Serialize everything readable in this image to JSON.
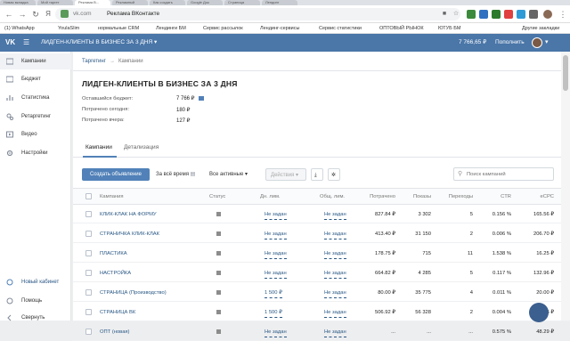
{
  "browser": {
    "tabs": [
      "Новая вкладка",
      "Мой таргет",
      "Реклама В...",
      "Рекламный",
      "Как создать",
      "Google Док",
      "Страница",
      "Лендинг"
    ],
    "url": "vk.com",
    "page_title": "Реклама ВКонтакте",
    "bookmarks": [
      "(1) WhatsApp",
      "YoulaSlim",
      "нормальные CRM",
      "Лендинги БМ",
      "Сервис рассылок",
      "Лендинг-сервисы",
      "Сервис статистики",
      "ОПТОВЫЙ РЫНОК",
      "ЮТУБ БМ",
      "Другие закладки"
    ]
  },
  "header": {
    "logo": "VK",
    "cabinet_name": "ЛИДГЕН-КЛИЕНТЫ В БИЗНЕС ЗА 3 ДНЯ",
    "balance": "7 766,65 ₽",
    "topup": "Пополнить"
  },
  "sidebar": {
    "items": [
      {
        "label": "Кампании",
        "icon": "campaigns-icon"
      },
      {
        "label": "Бюджет",
        "icon": "budget-icon"
      },
      {
        "label": "Статистика",
        "icon": "stats-icon"
      },
      {
        "label": "Ретаргетинг",
        "icon": "retarget-icon"
      },
      {
        "label": "Видео",
        "icon": "video-icon"
      },
      {
        "label": "Настройки",
        "icon": "settings-icon"
      }
    ],
    "bottom": [
      {
        "label": "Новый кабинет",
        "icon": "new-cabinet-icon"
      },
      {
        "label": "Помощь",
        "icon": "help-icon"
      },
      {
        "label": "Свернуть",
        "icon": "collapse-icon"
      }
    ]
  },
  "breadcrumb": {
    "first": "Таргетинг",
    "sep": "→",
    "second": "Кампании"
  },
  "page": {
    "title": "ЛИДГЕН-КЛИЕНТЫ В БИЗНЕС ЗА 3 ДНЯ",
    "stats": [
      {
        "label": "Оставшийся бюджет:",
        "value": "7 766 ₽"
      },
      {
        "label": "Потрачено сегодня:",
        "value": "180 ₽"
      },
      {
        "label": "Потрачено вчера:",
        "value": "127 ₽"
      }
    ]
  },
  "tabs": [
    "Кампании",
    "Детализация"
  ],
  "toolbar": {
    "create": "Создать объявление",
    "period": "За всё время",
    "filter": "Все активные",
    "actions": "Действия",
    "search_placeholder": "Поиск кампаний"
  },
  "table": {
    "headers": [
      "Кампания",
      "Статус",
      "Дн. лим.",
      "Общ. лим.",
      "Потрачено",
      "Показы",
      "Переходы",
      "CTR",
      "eCPC"
    ],
    "rows": [
      {
        "name": "КЛИК-КЛАК НА ФОРМУ",
        "day": "Не задан",
        "total": "Не задан",
        "spent": "827.84 ₽",
        "shows": "3 302",
        "clicks": "5",
        "ctr": "0.156 %",
        "ecpc": "165.56 ₽"
      },
      {
        "name": "СТРАНИЧКА КЛИК-КЛАК",
        "day": "Не задан",
        "total": "Не задан",
        "spent": "413.40 ₽",
        "shows": "31 150",
        "clicks": "2",
        "ctr": "0.006 %",
        "ecpc": "206.70 ₽"
      },
      {
        "name": "ПЛАСТИКА",
        "day": "Не задан",
        "total": "Не задан",
        "spent": "178.75 ₽",
        "shows": "715",
        "clicks": "11",
        "ctr": "1.538 %",
        "ecpc": "16.25 ₽"
      },
      {
        "name": "НАСТРОЙКА",
        "day": "Не задан",
        "total": "Не задан",
        "spent": "664.82 ₽",
        "shows": "4 285",
        "clicks": "5",
        "ctr": "0.117 %",
        "ecpc": "132.96 ₽"
      },
      {
        "name": "СТРАНИЦА (Производство)",
        "day": "1 500 ₽",
        "total": "Не задан",
        "spent": "80.00 ₽",
        "shows": "35 775",
        "clicks": "4",
        "ctr": "0.011 %",
        "ecpc": "20.00 ₽"
      },
      {
        "name": "СТРАНИЦА ВК",
        "day": "1 500 ₽",
        "total": "Не задан",
        "spent": "506.92 ₽",
        "shows": "56 328",
        "clicks": "2",
        "ctr": "0.004 %",
        "ecpc": "253.46 ₽"
      },
      {
        "name": "ОПТ (новая)",
        "day": "Не задан",
        "total": "Не задан",
        "spent": "...",
        "shows": "...",
        "clicks": "...",
        "ctr": "0.575 %",
        "ecpc": "48.29 ₽"
      }
    ]
  },
  "colors": {
    "vk_blue": "#4a76a8",
    "button_blue": "#5181b8",
    "link": "#2a5885"
  }
}
